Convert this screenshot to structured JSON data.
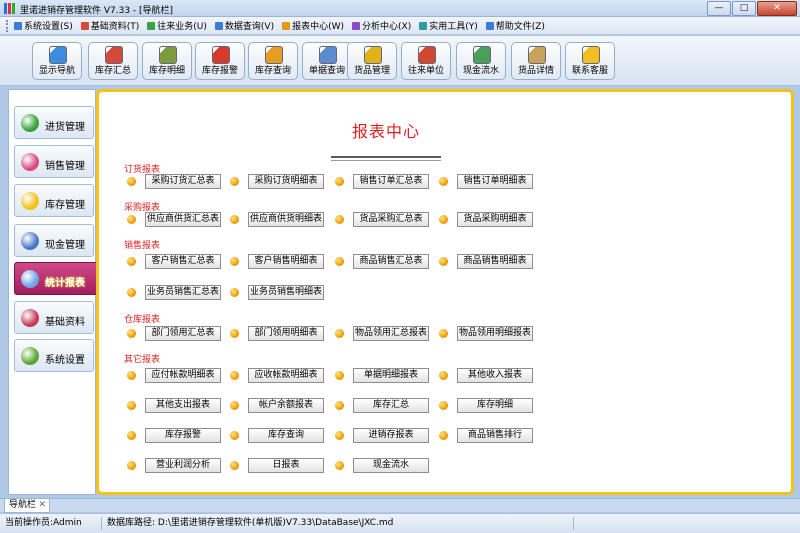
{
  "window": {
    "title": "里诺进销存管理软件 V7.33 - [导航栏]",
    "min": "—",
    "max": "□",
    "close": "✕"
  },
  "menu": [
    {
      "label": "系统设置(S)",
      "color": "#3b7bd8"
    },
    {
      "label": "基础资料(T)",
      "color": "#d94a3b"
    },
    {
      "label": "往来业务(U)",
      "color": "#3ca24a"
    },
    {
      "label": "数据查询(V)",
      "color": "#3b7bd8"
    },
    {
      "label": "报表中心(W)",
      "color": "#e19a1a"
    },
    {
      "label": "分析中心(X)",
      "color": "#8a4fc6"
    },
    {
      "label": "实用工具(Y)",
      "color": "#2d9da3"
    },
    {
      "label": "帮助文件(Z)",
      "color": "#3b7bd8"
    }
  ],
  "toolbar": [
    {
      "label": "显示导航",
      "color": "#3b8de0"
    },
    {
      "label": "库存汇总",
      "color": "#d34a3a"
    },
    {
      "label": "库存明细",
      "color": "#7b9d3e"
    },
    {
      "label": "库存报警",
      "color": "#d8392b"
    },
    {
      "label": "库存查询",
      "color": "#e59d22"
    },
    {
      "label": "单据查询",
      "color": "#5b8cd0"
    },
    {
      "label": "货品管理",
      "color": "#e0b21c"
    },
    {
      "label": "往来单位",
      "color": "#cf4830"
    },
    {
      "label": "现金流水",
      "color": "#4aa05a"
    },
    {
      "label": "货品详情",
      "color": "#c9a25a"
    },
    {
      "label": "联系客服",
      "color": "#f0c020"
    }
  ],
  "sidebar": [
    {
      "label": "进货管理",
      "color": "#37a33b"
    },
    {
      "label": "销售管理",
      "color": "#d94a83"
    },
    {
      "label": "库存管理",
      "color": "#f3c219"
    },
    {
      "label": "现金管理",
      "color": "#4b77c9"
    },
    {
      "label": "统计报表",
      "color": "#6ea2e3"
    },
    {
      "label": "基础资料",
      "color": "#c53c55"
    },
    {
      "label": "系统设置",
      "color": "#59a632"
    }
  ],
  "main": {
    "title": "报表中心",
    "sections": {
      "order": "订货报表",
      "purchase": "采购报表",
      "sales": "销售报表",
      "warehouse": "仓库报表",
      "other": "其它报表"
    },
    "buttons": {
      "order": [
        "采购订货汇总表",
        "采购订货明细表",
        "销售订单汇总表",
        "销售订单明细表"
      ],
      "purchase": [
        "供应商供货汇总表",
        "供应商供货明细表",
        "货品采购汇总表",
        "货品采购明细表"
      ],
      "sales1": [
        "客户销售汇总表",
        "客户销售明细表",
        "商品销售汇总表",
        "商品销售明细表"
      ],
      "sales2": [
        "业务员销售汇总表",
        "业务员销售明细表"
      ],
      "warehouse": [
        "部门领用汇总表",
        "部门领用明细表",
        "物品领用汇总报表",
        "物品领用明细报表"
      ],
      "other1": [
        "应付帐款明细表",
        "应收帐款明细表",
        "单据明细报表",
        "其他收入报表"
      ],
      "other2": [
        "其他支出报表",
        "帐户余额报表",
        "库存汇总",
        "库存明细"
      ],
      "other3": [
        "库存报警",
        "库存查询",
        "进销存报表",
        "商品销售排行"
      ],
      "other4": [
        "营业利润分析",
        "日报表",
        "现金流水"
      ]
    }
  },
  "tabs": {
    "nav": "导航栏",
    "close": "✕"
  },
  "status": {
    "operator": "当前操作员:Admin",
    "dbpath": "数据库路径: D:\\里诺进销存管理软件(单机版)V7.33\\DataBase\\JXC.md"
  }
}
